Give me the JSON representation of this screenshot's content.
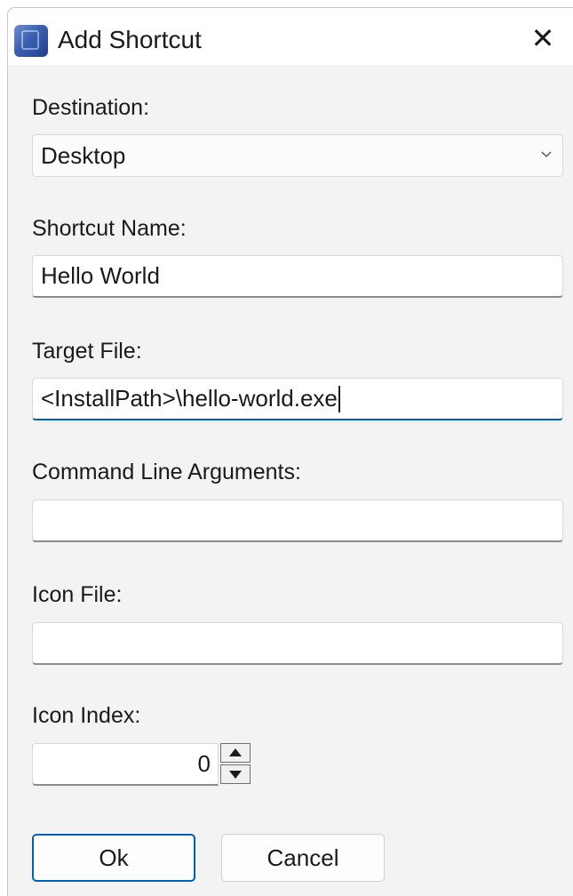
{
  "window": {
    "title": "Add Shortcut",
    "icon": "app-icon",
    "close_glyph": "✕"
  },
  "destination": {
    "label": "Destination:",
    "value": "Desktop",
    "icon": "chevron-down-icon"
  },
  "shortcut_name": {
    "label": "Shortcut Name:",
    "value": "Hello World"
  },
  "target_file": {
    "label": "Target File:",
    "value": "<InstallPath>\\hello-world.exe"
  },
  "command_line_arguments": {
    "label": "Command Line Arguments:",
    "value": ""
  },
  "icon_file": {
    "label": "Icon File:",
    "value": ""
  },
  "icon_index": {
    "label": "Icon Index:",
    "value": "0"
  },
  "buttons": {
    "ok": "Ok",
    "cancel": "Cancel"
  },
  "colors": {
    "accent": "#005fb8",
    "background": "#f3f3f3"
  }
}
